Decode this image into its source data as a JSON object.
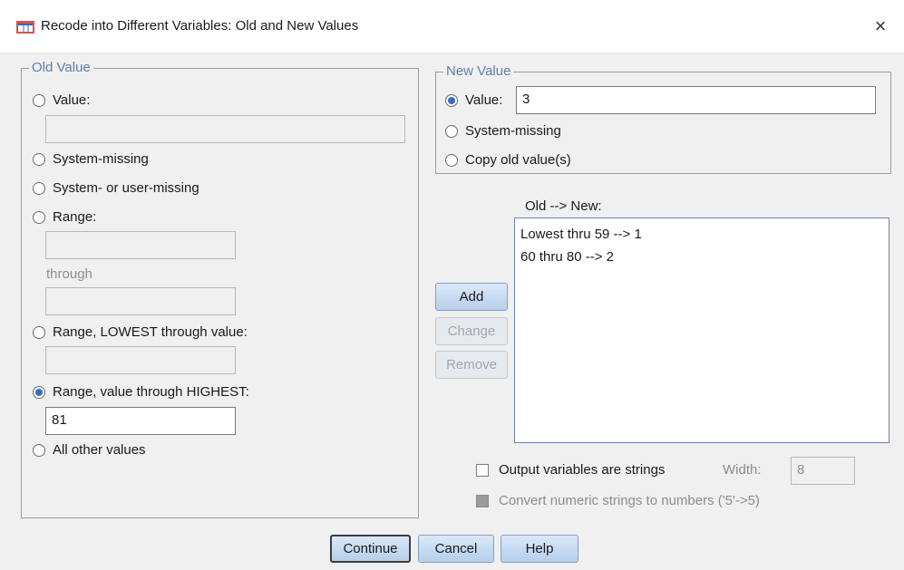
{
  "window": {
    "title": "Recode into Different Variables: Old and New Values",
    "app_icon": "spss-table-icon",
    "close_label": "×"
  },
  "old_value": {
    "legend": "Old Value",
    "options": {
      "value": {
        "label": "Value:",
        "selected": false,
        "input": ""
      },
      "system_missing": {
        "label": "System-missing",
        "selected": false
      },
      "system_or_user_missing": {
        "label": "System- or user-missing",
        "selected": false
      },
      "range": {
        "label": "Range:",
        "selected": false,
        "from": "",
        "through_label": "through",
        "to": ""
      },
      "range_lowest": {
        "label": "Range, LOWEST through value:",
        "selected": false,
        "input": ""
      },
      "range_highest": {
        "label": "Range, value through HIGHEST:",
        "selected": true,
        "input": "81"
      },
      "all_other": {
        "label": "All other values",
        "selected": false
      }
    }
  },
  "new_value": {
    "legend": "New Value",
    "options": {
      "value": {
        "label": "Value:",
        "selected": true,
        "input": "3"
      },
      "system_missing": {
        "label": "System-missing",
        "selected": false
      },
      "copy_old": {
        "label": "Copy old value(s)",
        "selected": false
      }
    }
  },
  "mapping": {
    "label": "Old --> New:",
    "items": [
      "Lowest thru 59 --> 1",
      "60 thru 80 --> 2"
    ]
  },
  "actions": {
    "add": "Add",
    "change": "Change",
    "remove": "Remove"
  },
  "options": {
    "output_strings": {
      "label": "Output variables are strings",
      "checked": false
    },
    "width": {
      "label": "Width:",
      "value": "8"
    },
    "convert_numeric": {
      "label": "Convert numeric strings to numbers ('5'->5)",
      "checked": false,
      "enabled": false
    }
  },
  "footer": {
    "continue": "Continue",
    "cancel": "Cancel",
    "help": "Help"
  }
}
